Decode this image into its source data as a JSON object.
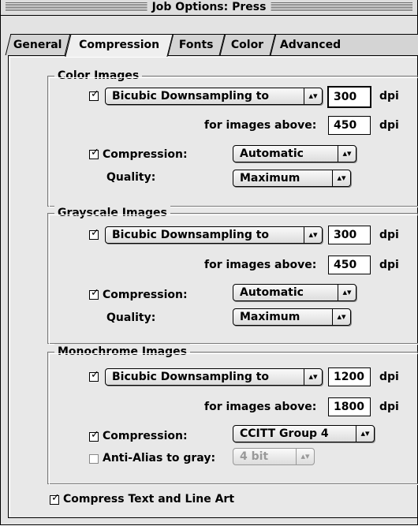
{
  "window": {
    "title": "Job Options: Press"
  },
  "tabs": [
    {
      "label": "General",
      "active": false
    },
    {
      "label": "Compression",
      "active": true
    },
    {
      "label": "Fonts",
      "active": false
    },
    {
      "label": "Color",
      "active": false
    },
    {
      "label": "Advanced",
      "active": false
    }
  ],
  "color_images": {
    "title": "Color Images",
    "downsample_checked": true,
    "downsample_method": "Bicubic Downsampling to",
    "resolution": "300",
    "resolution_unit": "dpi",
    "above_label": "for images above:",
    "above_value": "450",
    "above_unit": "dpi",
    "compression_checked": true,
    "compression_label": "Compression:",
    "compression_value": "Automatic",
    "quality_label": "Quality:",
    "quality_value": "Maximum"
  },
  "grayscale_images": {
    "title": "Grayscale Images",
    "downsample_checked": true,
    "downsample_method": "Bicubic Downsampling to",
    "resolution": "300",
    "resolution_unit": "dpi",
    "above_label": "for images above:",
    "above_value": "450",
    "above_unit": "dpi",
    "compression_checked": true,
    "compression_label": "Compression:",
    "compression_value": "Automatic",
    "quality_label": "Quality:",
    "quality_value": "Maximum"
  },
  "monochrome_images": {
    "title": "Monochrome Images",
    "downsample_checked": true,
    "downsample_method": "Bicubic Downsampling to",
    "resolution": "1200",
    "resolution_unit": "dpi",
    "above_label": "for images above:",
    "above_value": "1800",
    "above_unit": "dpi",
    "compression_checked": true,
    "compression_label": "Compression:",
    "compression_value": "CCITT Group 4",
    "antialias_checked": false,
    "antialias_label": "Anti-Alias to gray:",
    "antialias_value": "4 bit"
  },
  "compress_text": {
    "checked": true,
    "label": "Compress Text and Line Art"
  },
  "icons": {
    "checkmark": "✓",
    "popup_arrows": "◆"
  }
}
